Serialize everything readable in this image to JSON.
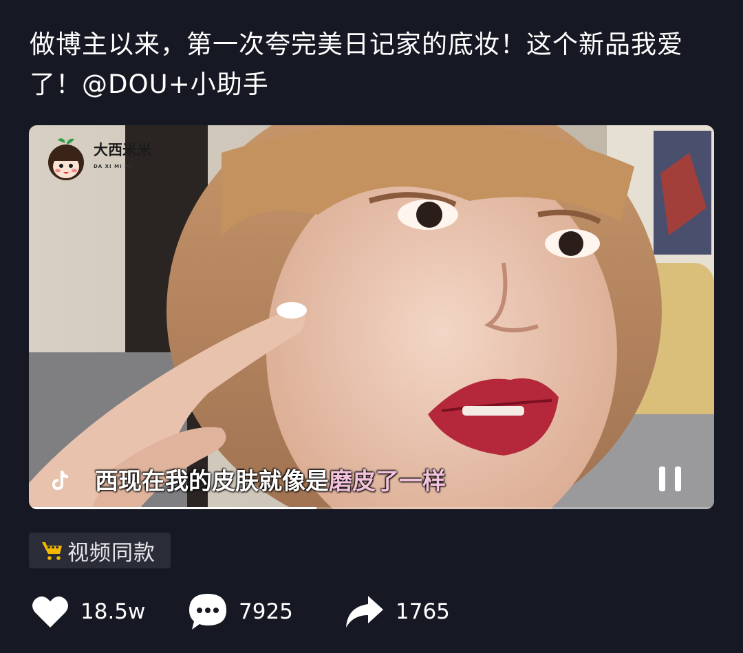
{
  "post": {
    "caption": "做博主以来，第一次夸完美日记家的底妆！这个新品我爱了！@DOU+小助手"
  },
  "video": {
    "watermark_logo": "大西米米",
    "watermark_sub": "DA XI MI MI",
    "subtitle_main": "西现在我的皮肤就像是",
    "subtitle_highlight": "磨皮了一样",
    "progress_fraction": 0.42,
    "state": "playing"
  },
  "product_tag": {
    "label": "视频同款",
    "icon": "shopping-cart-icon"
  },
  "actions": {
    "like": {
      "icon": "heart-icon",
      "count": "18.5w"
    },
    "comment": {
      "icon": "comment-bubble-icon",
      "count": "7925"
    },
    "share": {
      "icon": "share-arrow-icon",
      "count": "1765"
    }
  },
  "colors": {
    "background": "#161823",
    "cart_yellow": "#f5b800",
    "tag_bg": "#2a2c37",
    "subtitle_pink": "#f2c2dc"
  }
}
